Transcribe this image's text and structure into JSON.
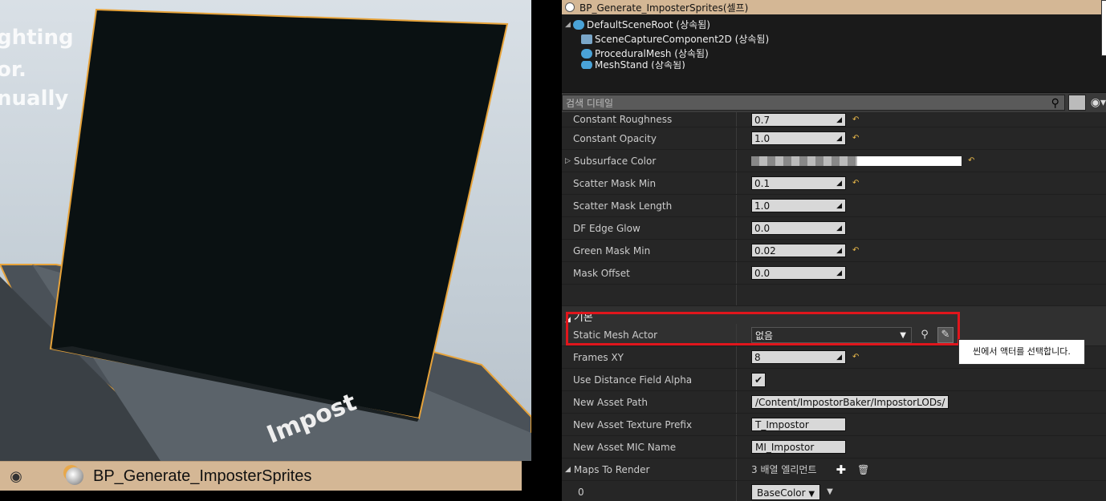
{
  "viewport": {
    "bg_text_lines": [
      "ghting",
      "or.",
      "nually"
    ],
    "floor_text": "Impost",
    "actor_name": "BP_Generate_ImposterSprites"
  },
  "panel": {
    "title": "BP_Generate_ImposterSprites(셀프)",
    "tree": [
      {
        "label": "DefaultSceneRoot (상속됨)",
        "indent": 0
      },
      {
        "label": "SceneCaptureComponent2D (상속됨)",
        "indent": 1
      },
      {
        "label": "ProceduralMesh (상속됨)",
        "indent": 1
      },
      {
        "label": "MeshStand (상속됨)",
        "indent": 1
      }
    ],
    "search_placeholder": "검색 디테일",
    "rows": [
      {
        "label": "Constant Roughness",
        "value": "0.7",
        "reset": true
      },
      {
        "label": "Constant Opacity",
        "value": "1.0",
        "reset": true
      },
      {
        "label": "Subsurface Color",
        "value": "",
        "reset": true
      },
      {
        "label": "Scatter Mask Min",
        "value": "0.1",
        "reset": true
      },
      {
        "label": "Scatter Mask Length",
        "value": "1.0",
        "reset": false
      },
      {
        "label": "DF Edge Glow",
        "value": "0.0",
        "reset": false
      },
      {
        "label": "Green Mask Min",
        "value": "0.02",
        "reset": true
      },
      {
        "label": "Mask Offset",
        "value": "0.0",
        "reset": false
      }
    ],
    "section": "기본",
    "static_mesh_actor": {
      "label": "Static Mesh Actor",
      "value": "없음"
    },
    "frames_xy": {
      "label": "Frames XY",
      "value": "8"
    },
    "use_df_alpha": {
      "label": "Use Distance Field Alpha"
    },
    "asset_path": {
      "label": "New Asset Path",
      "value": "/Content/ImpostorBaker/ImpostorLODs/"
    },
    "texture_prefix": {
      "label": "New Asset Texture Prefix",
      "value": "T_Impostor"
    },
    "mic_name": {
      "label": "New Asset MIC Name",
      "value": "MI_Impostor"
    },
    "maps": {
      "label": "Maps To Render",
      "value": "3 배열 엘리먼트"
    },
    "map0": {
      "label": "0",
      "value": "BaseColor"
    },
    "tooltip": "씬에서 액터를 선택합니다."
  }
}
